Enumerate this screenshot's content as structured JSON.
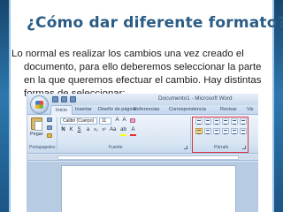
{
  "slide": {
    "title": "¿Cómo dar diferente formato?",
    "body": "Lo normal es realizar los cambios una vez creado el documento, para ello deberemos seleccionar la parte en la que queremos efectuar el cambio. Hay distintas formas de seleccionar:",
    "accent_color": "#2b5c86"
  },
  "word": {
    "window_title": "Documento1 - Microsoft Word",
    "tabs": [
      "Inicio",
      "Insertar",
      "Diseño de página",
      "Referencias",
      "Correspondencia",
      "Revisar",
      "Vis"
    ],
    "active_tab": "Inicio",
    "paste_label": "Pegar",
    "font_name": "Calibri (Cuerpo)",
    "font_size": "11",
    "group_labels": [
      "Portapapeles",
      "Fuente",
      "Párrafo"
    ],
    "highlight_color": "#d9323f"
  }
}
